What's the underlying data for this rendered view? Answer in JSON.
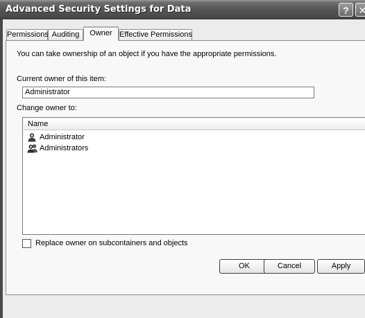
{
  "window": {
    "title": "Advanced Security Settings for Data",
    "help_glyph": "?",
    "close_glyph": "✕"
  },
  "tabs": [
    {
      "label": "Permissions",
      "active": false
    },
    {
      "label": "Auditing",
      "active": false
    },
    {
      "label": "Owner",
      "active": true
    },
    {
      "label": "Effective Permissions",
      "active": false
    }
  ],
  "owner": {
    "intro": "You can take ownership of an object if you have the appropriate permissions.",
    "current_owner_label": "Current owner of this item:",
    "current_owner_value": "Administrator",
    "change_owner_label": "Change owner to:",
    "list_header": "Name",
    "list_items": [
      {
        "name": "Administrator",
        "icon": "user-icon"
      },
      {
        "name": "Administrators",
        "icon": "group-icon"
      }
    ],
    "replace_checkbox_label": "Replace owner on subcontainers and objects",
    "replace_checked": false
  },
  "buttons": {
    "ok": "OK",
    "cancel": "Cancel",
    "apply": "Apply"
  }
}
